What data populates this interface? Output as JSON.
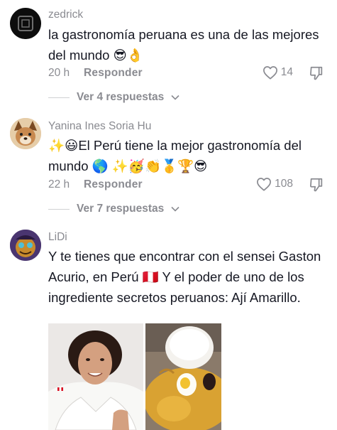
{
  "comments": [
    {
      "username": "zedrick",
      "text": "la gastronomía peruana es una de las mejores del mundo 😎👌",
      "time": "20 h",
      "reply_label": "Responder",
      "likes": "14",
      "view_replies": "Ver 4 respuestas"
    },
    {
      "username": "Yanina Ines Soria Hu",
      "text": "✨😃El Perú tiene la mejor gastronomía del mundo 🌎 ✨🥳👏🥇🏆😎",
      "time": "22 h",
      "reply_label": "Responder",
      "likes": "108",
      "view_replies": "Ver 7 respuestas"
    },
    {
      "username": "LiDi",
      "text": "Y te tienes que encontrar con el sensei Gaston Acurio, en Perú 🇵🇪 Y el poder de uno de los ingrediente secretos peruanos: Ají Amarillo."
    }
  ],
  "colors": {
    "text": "#161823",
    "muted": "#8a8b91",
    "divider": "#d0d1d3"
  },
  "icons": [
    "heart-icon",
    "dislike-icon",
    "chevron-down-icon"
  ]
}
